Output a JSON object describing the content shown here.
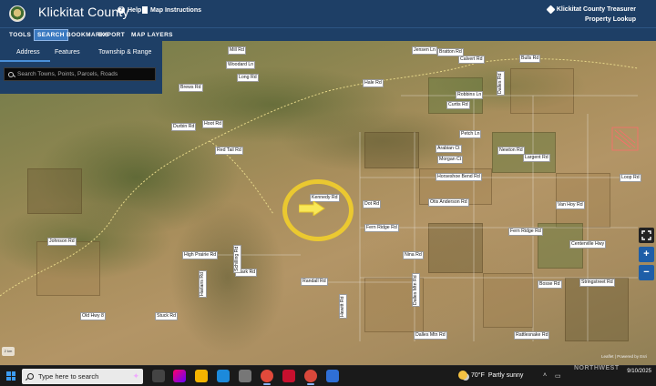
{
  "header": {
    "title": "Klickitat County",
    "help": "Help",
    "map_instructions": "Map Instructions",
    "treasurer_line1": "Klickitat County Treasurer",
    "treasurer_line2": "Property Lookup"
  },
  "toolbar": {
    "tabs": [
      "TOOLS",
      "SEARCH",
      "BOOKMARKS",
      "EXPORT",
      "MAP LAYERS"
    ],
    "active_tab": "SEARCH"
  },
  "search": {
    "subtabs": [
      "Address",
      "Features",
      "Township & Range"
    ],
    "active_subtab": "Address",
    "placeholder": "Search Towns, Points, Parcels, Roads"
  },
  "map": {
    "road_labels": [
      "Mill Rd",
      "Woodard Ln",
      "Long Rd",
      "Brews Rd",
      "Jensen Ln",
      "Bratton Rd",
      "Calvert Rd",
      "Bulls Rd",
      "Hale Rd",
      "Robbins Ln",
      "Curtis Rd",
      "Dalles Rd",
      "Durbin Rd",
      "Hoot Rd",
      "Red Tail Rd",
      "Arabian Ct",
      "Morgan Ct",
      "Petch Ln",
      "Newton Rd",
      "Largent Rd",
      "Horseshoe Bend Rd",
      "Otis Anderson Rd",
      "Van Hoy Rd",
      "Fern Ridge Rd",
      "Centerville Hwy",
      "Loop Rd",
      "High Prairie Rd",
      "Clark Rd",
      "Nina Rd",
      "Randall Rd",
      "Stringstreet Rd",
      "Bosse Rd",
      "Dalles Mtn Rd",
      "Rattlesnake Rd",
      "Johnson Rd",
      "Stuck Rd",
      "Schilling Rd",
      "Harlans Rd",
      "Dalles Mtn Rd",
      "Kennedy Rd",
      "Dot Rd",
      "Old Hwy 8",
      "Fern Ridge Rd",
      "Hewitt Rd"
    ],
    "controls": {
      "fullscreen_icon": "fullscreen-icon",
      "zoom_in": "+",
      "zoom_out": "−"
    },
    "attribution": "Leaflet | Powered by Esri",
    "scale_text": "2 km"
  },
  "taskbar": {
    "search_placeholder": "Type here to search",
    "weather_temp": "70°F",
    "weather_text": "Partly sunny",
    "clock_time": "",
    "clock_date": "9/10/2025",
    "watermark": "NORTHWEST"
  },
  "colors": {
    "header_bg": "#1e3f66",
    "active_tab": "#3a79c0",
    "highlight": "#f6d228",
    "zoom_btn": "#1e5ea8"
  }
}
